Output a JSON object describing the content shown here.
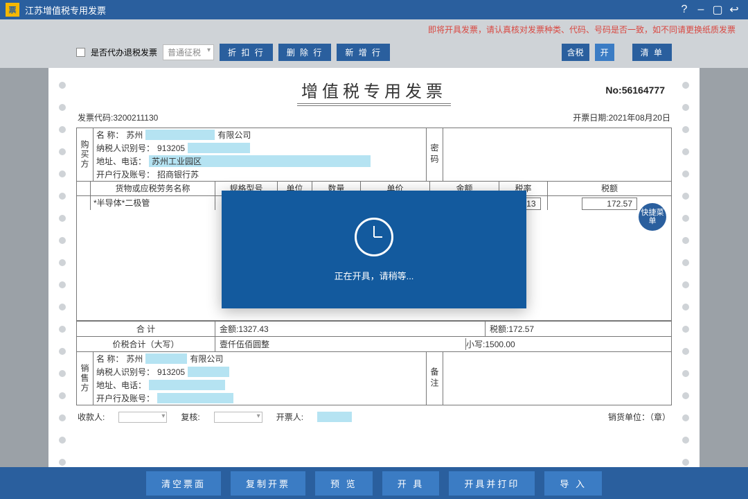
{
  "titlebar": {
    "title": "江苏增值税专用发票"
  },
  "warning": "即将开具发票，请认真核对发票种类、代码、号码是否一致，如不同请更换纸质发票",
  "toolbar": {
    "proxy_label": "是否代办退税发票",
    "tax_mode": "普通征税",
    "discount_btn": "折 扣 行",
    "delete_btn": "删 除 行",
    "add_btn": "新 增 行",
    "tax_incl": "含税",
    "open": "开",
    "list": "清  单"
  },
  "invoice": {
    "title": "增值税专用发票",
    "no_label": "No:",
    "no": "56164777",
    "code_label": "发票代码:",
    "code": "3200211130",
    "date_label": "开票日期:",
    "date": "2021年08月20日",
    "buyer": {
      "heading": "购买方",
      "name_label": "名        称：",
      "name_prefix": "苏州",
      "name_suffix": "有限公司",
      "taxno_label": "纳税人识别号：",
      "taxno": "913205",
      "addr_label": "地址、电话：",
      "addr": "苏州工业园区",
      "bank_label": "开户行及账号：",
      "bank": "招商银行苏"
    },
    "mima": "密码",
    "quick_menu": "快捷菜单",
    "columns": {
      "name": "货物或应税劳务名称",
      "spec": "规格型号",
      "unit": "单位",
      "qty": "数量",
      "price": "单价",
      "amount": "金额",
      "rate": "税率",
      "tax": "税额"
    },
    "item": {
      "name": "*半导体*二极管",
      "rate": "0.13",
      "tax": "172.57"
    },
    "totals": {
      "label": "合    计",
      "amount_label": "金额:",
      "amount": "1327.43",
      "tax_label": "税额:",
      "tax": "172.57"
    },
    "caps": {
      "label": "价税合计（大写）",
      "upper": "壹仟伍佰圆整",
      "lower_label": "小写:",
      "lower": "1500.00"
    },
    "seller": {
      "heading": "销售方",
      "name_label": "名        称：",
      "name_prefix": "苏州",
      "name_suffix": "有限公司",
      "taxno_label": "纳税人识别号：",
      "taxno": "913205",
      "addr_label": "地址、电话：",
      "bank_label": "开户行及账号："
    },
    "remark": "备注"
  },
  "signature": {
    "payee": "收款人:",
    "reviewer": "复核:",
    "issuer": "开票人:",
    "seller_unit": "销货单位：（章）"
  },
  "bottombar": {
    "clear": "清空票面",
    "copy": "复制开票",
    "preview": "预  览",
    "issue": "开  具",
    "issue_print": "开具并打印",
    "import": "导  入"
  },
  "modal": {
    "text": "正在开具，请稍等..."
  }
}
